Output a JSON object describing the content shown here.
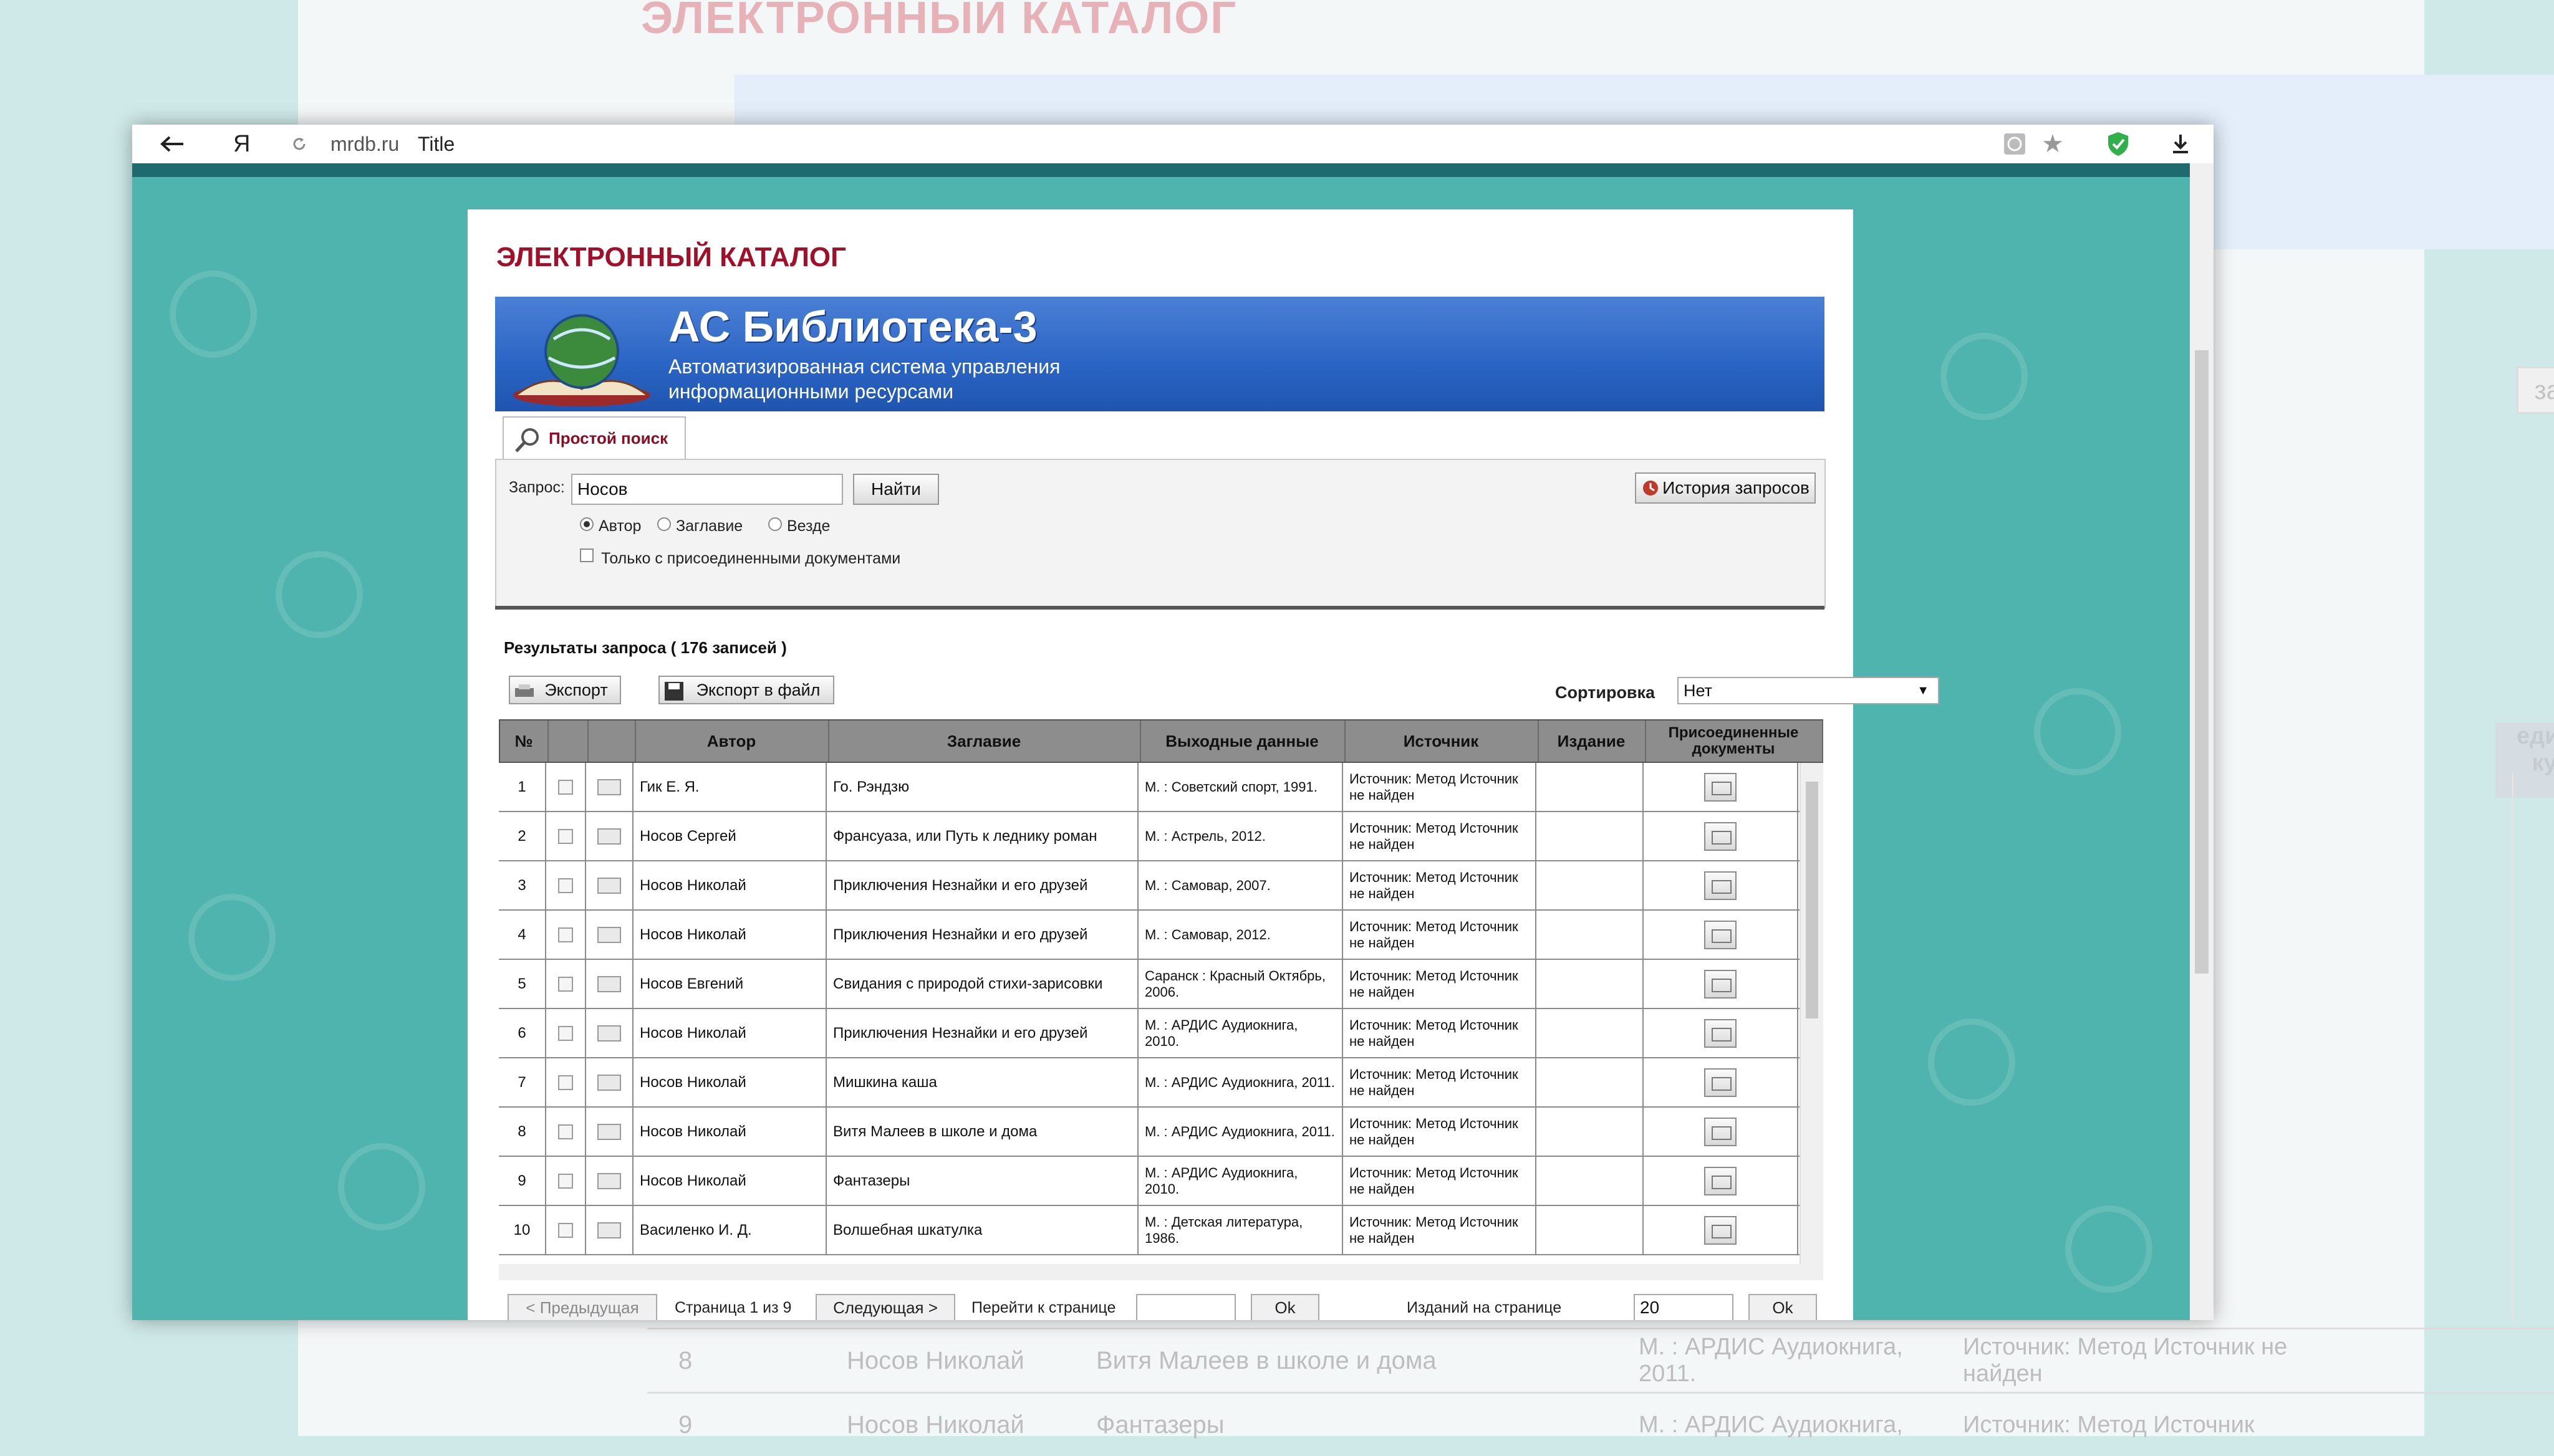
{
  "background": {
    "title": "ЭЛЕКТРОННЫЙ КАТАЛОГ",
    "history_button": "запросов",
    "column_header": "единенные кументы",
    "rows": [
      {
        "num": "8",
        "author": "Носов Николай",
        "title": "Витя Малеев в школе и дома",
        "imprint": "М. : АРДИС Аудиокнига, 2011.",
        "source": "Источник: Метод Источник не найден"
      },
      {
        "num": "9",
        "author": "Носов Николай",
        "title": "Фантазеры",
        "imprint": "М. : АРДИС Аудиокнига,",
        "source": "Источник: Метод Источник"
      }
    ]
  },
  "browser": {
    "back_icon": "arrow-left",
    "logo": "Я",
    "domain": "mrdb.ru",
    "page_title": "Title",
    "icons": [
      "reload-icon",
      "translate-icon",
      "star-icon",
      "shield-icon",
      "download-icon"
    ]
  },
  "page": {
    "catalog_title": "ЭЛЕКТРОННЫЙ КАТАЛОГ",
    "banner": {
      "title": "АС Библиотека-3",
      "subtitle_line1": "Автоматизированная система управления",
      "subtitle_line2": "информационными ресурсами"
    },
    "tab": "Простой поиск",
    "search": {
      "query_label": "Запрос:",
      "query_value": "Носов",
      "find_button": "Найти",
      "history_button": "История запросов",
      "radios": [
        "Автор",
        "Заглавие",
        "Везде"
      ],
      "selected_radio": "Автор",
      "attached_only": "Только с присоединенными документами"
    },
    "results": {
      "title": "Результаты запроса ( 176 записей )",
      "export_button": "Экспорт",
      "export_file_button": "Экспорт в файл",
      "sort_label": "Сортировка",
      "sort_value": "Нет"
    },
    "table": {
      "headers": {
        "num": "№",
        "author": "Автор",
        "title": "Заглавие",
        "imprint": "Выходные данные",
        "source": "Источник",
        "edition": "Издание",
        "attached": "Присоединенные документы"
      },
      "rows": [
        {
          "num": "1",
          "author": "Гик Е. Я.",
          "title": "Го. Рэндзю",
          "imprint": "М. : Советский спорт, 1991.",
          "source": "Источник: Метод Источник не найден"
        },
        {
          "num": "2",
          "author": "Носов Сергей",
          "title": "Франсуаза, или Путь к леднику роман",
          "imprint": "М. : Астрель, 2012.",
          "source": "Источник: Метод Источник не найден"
        },
        {
          "num": "3",
          "author": "Носов Николай",
          "title": "Приключения Незнайки и его друзей",
          "imprint": "М. : Самовар, 2007.",
          "source": "Источник: Метод Источник не найден"
        },
        {
          "num": "4",
          "author": "Носов Николай",
          "title": "Приключения Незнайки и его друзей",
          "imprint": "М. : Самовар, 2012.",
          "source": "Источник: Метод Источник не найден"
        },
        {
          "num": "5",
          "author": "Носов Евгений",
          "title": "Свидания с природой стихи-зарисовки",
          "imprint": "Саранск : Красный Октябрь, 2006.",
          "source": "Источник: Метод Источник не найден"
        },
        {
          "num": "6",
          "author": "Носов Николай",
          "title": "Приключения Незнайки и его друзей",
          "imprint": "М. : АРДИС Аудиокнига, 2010.",
          "source": "Источник: Метод Источник не найден"
        },
        {
          "num": "7",
          "author": "Носов Николай",
          "title": "Мишкина каша",
          "imprint": "М. : АРДИС Аудиокнига, 2011.",
          "source": "Источник: Метод Источник не найден"
        },
        {
          "num": "8",
          "author": "Носов Николай",
          "title": "Витя Малеев в школе и дома",
          "imprint": "М. : АРДИС Аудиокнига, 2011.",
          "source": "Источник: Метод Источник не найден"
        },
        {
          "num": "9",
          "author": "Носов Николай",
          "title": "Фантазеры",
          "imprint": "М. : АРДИС Аудиокнига, 2010.",
          "source": "Источник: Метод Источник не найден"
        },
        {
          "num": "10",
          "author": "Василенко И. Д.",
          "title": "Волшебная шкатулка",
          "imprint": "М. : Детская литература, 1986.",
          "source": "Источник: Метод Источник не найден"
        }
      ]
    },
    "pager": {
      "prev": "< Предыдущая",
      "page_info": "Страница 1 из 9",
      "next": "Следующая >",
      "goto_label": "Перейти к странице",
      "ok": "Ok",
      "per_page_label": "Изданий на странице",
      "per_page_value": "20",
      "ok2": "Ok"
    }
  },
  "colors": {
    "teal_background": "#4fb4ad",
    "title_red": "#a0102a",
    "banner_blue": "#2a64c4",
    "header_gray": "#8d8d8d"
  }
}
